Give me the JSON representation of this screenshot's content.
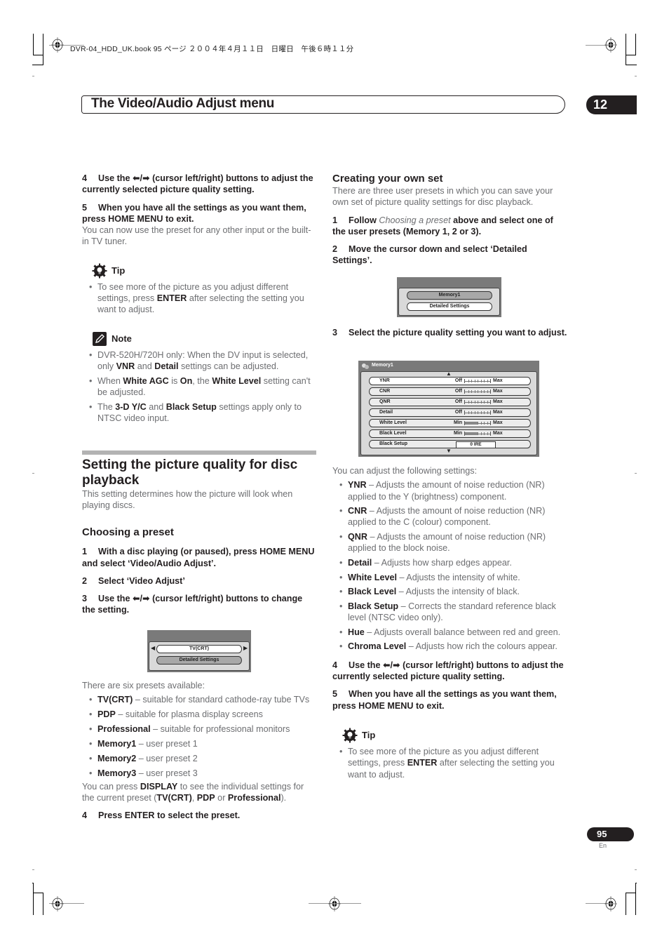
{
  "print_header": {
    "file_info": "DVR-04_HDD_UK.book  95 ページ  ２００４年４月１１日　日曜日　午後６時１１分"
  },
  "chapter": {
    "title": "The Video/Audio Adjust menu",
    "number": "12"
  },
  "left_column": {
    "step4": {
      "num": "4",
      "text": "Use the ⬅/➡ (cursor left/right) buttons to adjust the currently selected picture quality setting."
    },
    "step5": {
      "num": "5",
      "text": "When you have all the settings as you want them, press HOME MENU to exit."
    },
    "step5_body": "You can now use the preset for any other input or the built-in TV tuner.",
    "tip": {
      "icon": "lightbulb-gear-icon",
      "heading": "Tip",
      "items": [
        {
          "pre": "To see more of the picture as you adjust different settings, press ",
          "bold": "ENTER",
          "post": " after selecting the setting you want to adjust."
        }
      ]
    },
    "note": {
      "icon": "pencil-icon",
      "heading": "Note",
      "items": [
        {
          "parts": [
            {
              "t": "DVR-520H/720H only: When the DV input is selected, only "
            },
            {
              "b": "VNR"
            },
            {
              "t": " and "
            },
            {
              "b": "Detail"
            },
            {
              "t": " settings can be adjusted."
            }
          ]
        },
        {
          "parts": [
            {
              "t": "When "
            },
            {
              "b": "White AGC"
            },
            {
              "t": " is "
            },
            {
              "b": "On"
            },
            {
              "t": ", the "
            },
            {
              "b": "White Level"
            },
            {
              "t": " setting can't be adjusted."
            }
          ]
        },
        {
          "parts": [
            {
              "t": "The "
            },
            {
              "b": "3-D Y/C"
            },
            {
              "t": " and "
            },
            {
              "b": "Black Setup"
            },
            {
              "t": " settings apply only to NTSC video input."
            }
          ]
        }
      ]
    },
    "section": {
      "heading": "Setting the picture quality for disc playback",
      "intro": "This setting determines how the picture will look when playing discs."
    },
    "choosing": {
      "heading": "Choosing a preset",
      "step1": {
        "num": "1",
        "text": "With a disc playing (or paused), press HOME MENU and select ‘Video/Audio Adjust’."
      },
      "step2": {
        "num": "2",
        "text": "Select ‘Video Adjust’"
      },
      "step3": {
        "num": "3",
        "text": "Use the ⬅/➡ (cursor left/right) buttons to change the setting."
      },
      "osd": {
        "preset_value": "TV(CRT)",
        "detailed_settings": "Detailed Settings",
        "arrow_left": "◀",
        "arrow_right": "▶"
      },
      "presets_intro": "There are six presets available:",
      "presets": [
        {
          "name": "TV(CRT)",
          "desc": " – suitable for standard cathode-ray tube TVs"
        },
        {
          "name": "PDP",
          "desc": " – suitable for plasma display screens"
        },
        {
          "name": "Professional",
          "desc": " – suitable for professional monitors"
        },
        {
          "name": "Memory1",
          "desc": " – user preset 1"
        },
        {
          "name": "Memory2",
          "desc": " – user preset 2"
        },
        {
          "name": "Memory3",
          "desc": " – user preset 3"
        }
      ],
      "display_note": {
        "p1": "You can press ",
        "b1": "DISPLAY",
        "p2": " to see the individual settings for the current preset (",
        "b2": "TV(CRT)",
        "p3": ", ",
        "b3": "PDP",
        "p4": " or ",
        "b4": "Professional",
        "p5": ")."
      },
      "step4": {
        "num": "4",
        "text": "Press ENTER to select the preset."
      }
    }
  },
  "right_column": {
    "heading": "Creating your own set",
    "intro": "There are three user presets in which you can save your own set of picture quality settings for disc playback.",
    "step1": {
      "num": "1",
      "pre": "Follow ",
      "italic": "Choosing a preset",
      "post": " above and select one of the user presets (Memory 1, 2 or 3)."
    },
    "step2": {
      "num": "2",
      "text": "Move the cursor down and select ‘Detailed Settings’."
    },
    "osd_small": {
      "preset_value": "Memory1",
      "detailed_settings": "Detailed Settings"
    },
    "step3": {
      "num": "3",
      "text": "Select the picture quality setting you want to adjust."
    },
    "osd_detail": {
      "title": "Memory1",
      "scroll_up": "▲",
      "scroll_down": "▼",
      "rows": [
        {
          "label": "YNR",
          "low": "Off",
          "high": "Max",
          "level": 0,
          "type": "slider"
        },
        {
          "label": "CNR",
          "low": "Off",
          "high": "Max",
          "level": 0,
          "type": "slider"
        },
        {
          "label": "QNR",
          "low": "Off",
          "high": "Max",
          "level": 0,
          "type": "slider"
        },
        {
          "label": "Detail",
          "low": "Off",
          "high": "Max",
          "level": 0,
          "type": "slider"
        },
        {
          "label": "White Level",
          "low": "Min",
          "high": "Max",
          "level": 0.5,
          "type": "slider"
        },
        {
          "label": "Black Level",
          "low": "Min",
          "high": "Max",
          "level": 0.5,
          "type": "slider"
        },
        {
          "label": "Black Setup",
          "value": "0 IRE",
          "type": "box"
        }
      ]
    },
    "adjust_intro": "You can adjust the following settings:",
    "settings": [
      {
        "name": "YNR",
        "desc": " – Adjusts the amount of noise reduction (NR) applied to the Y (brightness) component."
      },
      {
        "name": "CNR",
        "desc": " – Adjusts the amount of noise reduction (NR) applied to the C (colour) component."
      },
      {
        "name": "QNR",
        "desc": " – Adjusts the amount of noise reduction (NR) applied to the block noise."
      },
      {
        "name": "Detail",
        "desc": " – Adjusts how sharp edges appear."
      },
      {
        "name": "White Level",
        "desc": " – Adjusts the intensity of white."
      },
      {
        "name": "Black Level",
        "desc": " – Adjusts the intensity of black."
      },
      {
        "name": "Black Setup",
        "desc": " – Corrects the standard reference black level (NTSC video only)."
      },
      {
        "name": "Hue",
        "desc": " – Adjusts overall balance between red and green."
      },
      {
        "name": "Chroma Level",
        "desc": " – Adjusts how rich the colours appear."
      }
    ],
    "step4": {
      "num": "4",
      "text": "Use the ⬅/➡ (cursor left/right) buttons to adjust the currently selected picture quality setting."
    },
    "step5": {
      "num": "5",
      "text": "When you have all the settings as you want them, press HOME MENU to exit."
    },
    "tip": {
      "heading": "Tip",
      "pre": "To see more of the picture as you adjust different settings, press ",
      "bold": "ENTER",
      "post": " after selecting the setting you want to adjust."
    }
  },
  "footer": {
    "page_number": "95",
    "language": "En"
  }
}
